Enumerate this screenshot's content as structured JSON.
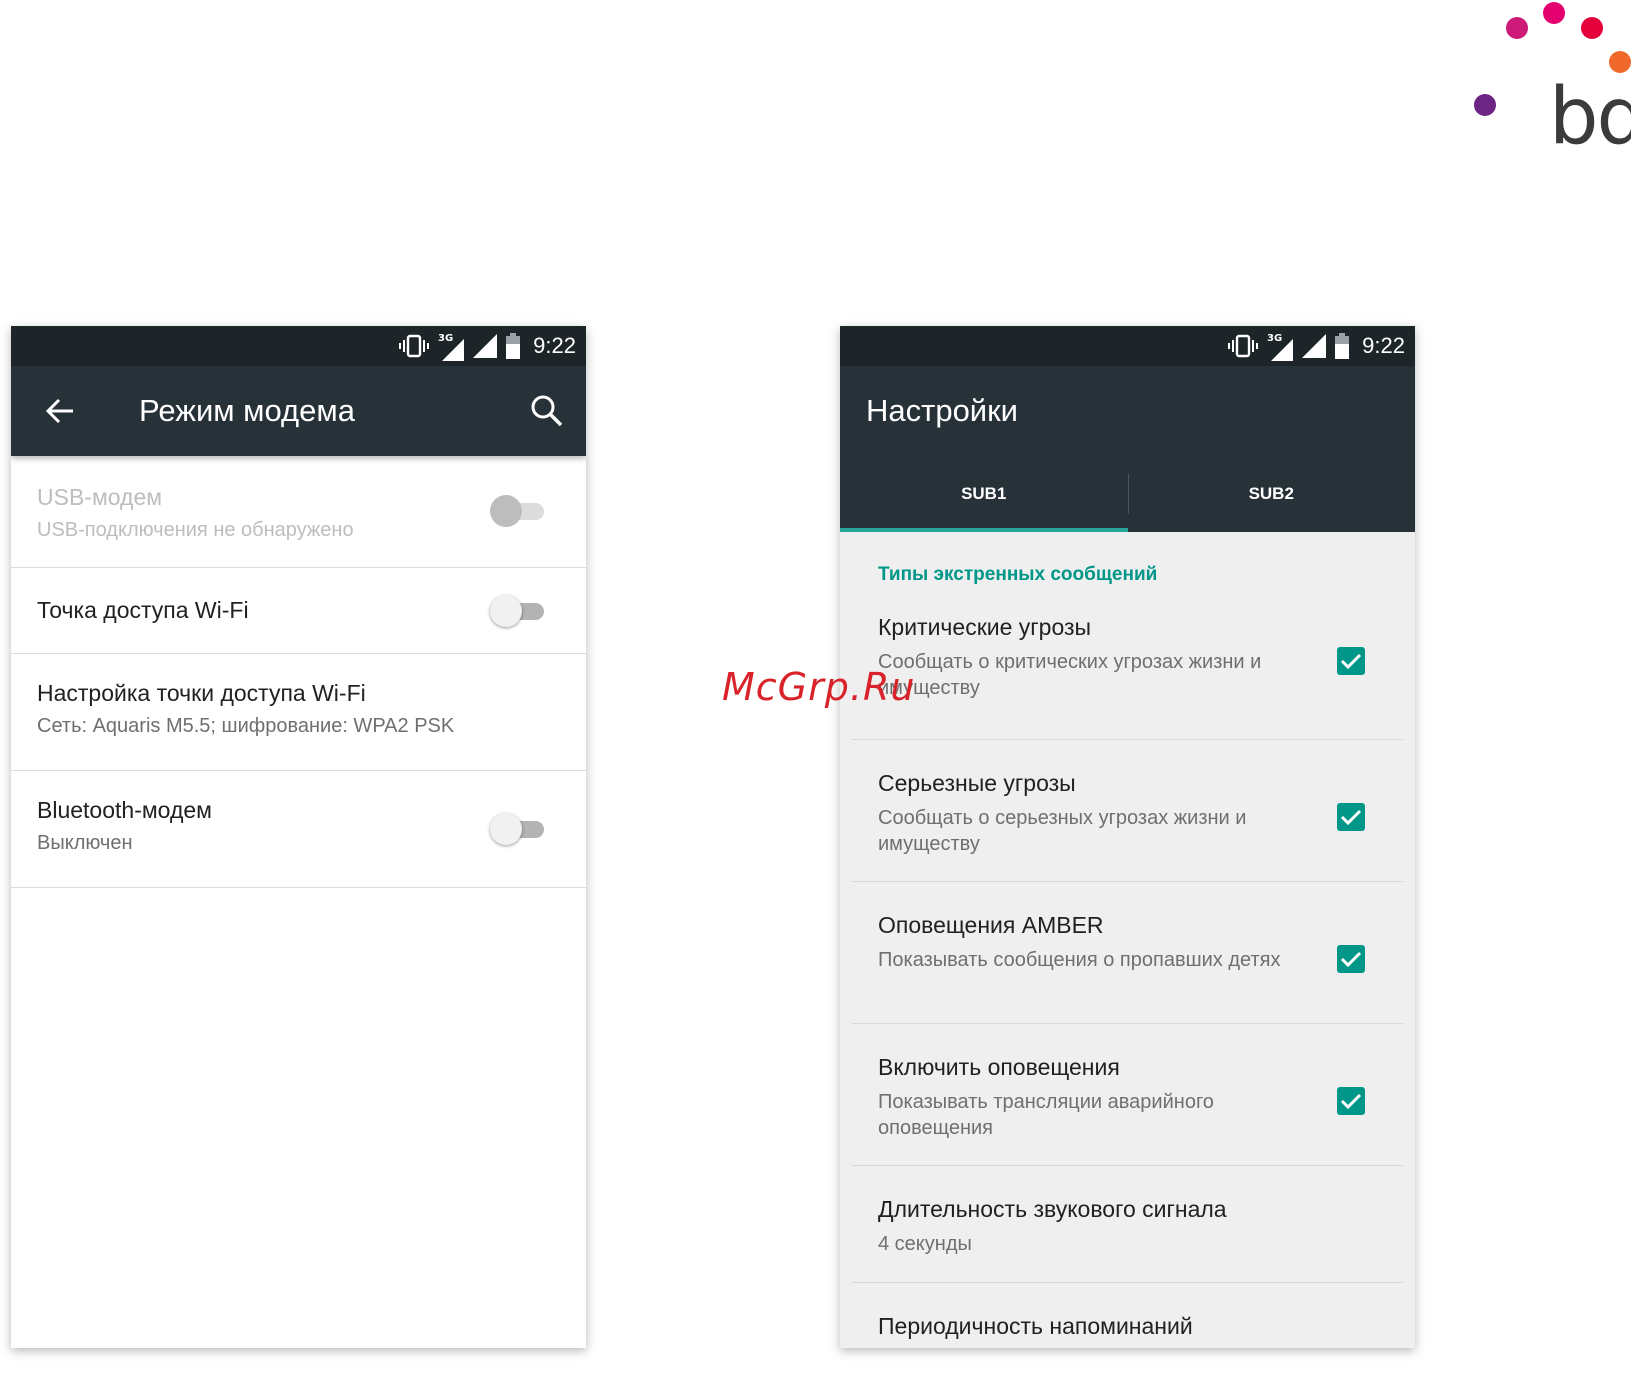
{
  "brand": {
    "logo_text": "bq",
    "dot_colors": [
      "#cc1a79",
      "#e4006e",
      "#e3003b",
      "#f0692b",
      "#6c2585"
    ]
  },
  "watermark": "McGrp.Ru",
  "colors": {
    "accent": "#009688",
    "statusbar": "#1d2528",
    "appbar": "#263238"
  },
  "left_screen": {
    "status": {
      "network": "3G",
      "time": "9:22",
      "icons": [
        "vibrate-icon",
        "signal-3g-icon",
        "signal-icon",
        "battery-icon"
      ]
    },
    "appbar": {
      "title": "Режим модема",
      "icons": [
        "back-arrow-icon",
        "search-icon"
      ]
    },
    "items": [
      {
        "title": "USB-модем",
        "subtitle": "USB-подключения не обнаружено",
        "toggle": "off",
        "enabled": false
      },
      {
        "title": "Точка доступа Wi-Fi",
        "subtitle": "",
        "toggle": "off",
        "enabled": true
      },
      {
        "title": "Настройка точки доступа Wi-Fi",
        "subtitle": "Сеть: Aquaris M5.5; шифрование: WPA2 PSK",
        "enabled": true
      },
      {
        "title": "Bluetooth-модем",
        "subtitle": "Выключен",
        "toggle": "off",
        "enabled": true
      }
    ]
  },
  "right_screen": {
    "status": {
      "network": "3G",
      "time": "9:22",
      "icons": [
        "vibrate-icon",
        "signal-3g-icon",
        "signal-icon",
        "battery-icon"
      ]
    },
    "appbar": {
      "title": "Настройки"
    },
    "tabs": [
      {
        "label": "SUB1",
        "active": true
      },
      {
        "label": "SUB2",
        "active": false
      }
    ],
    "section_header": "Типы экстренных сообщений",
    "items": [
      {
        "title": "Критические угрозы",
        "subtitle": "Сообщать о критических угрозах жизни и имуществу",
        "checked": true
      },
      {
        "title": "Серьезные угрозы",
        "subtitle": "Сообщать о серьезных угрозах жизни и имуществу",
        "checked": true
      },
      {
        "title": "Оповещения AMBER",
        "subtitle": "Показывать сообщения о пропавших детях",
        "checked": true
      },
      {
        "title": "Включить оповещения",
        "subtitle": "Показывать трансляции аварийного оповещения",
        "checked": true
      },
      {
        "title": "Длительность звукового сигнала",
        "subtitle": "4 секунды"
      },
      {
        "title": "Периодичность напоминаний",
        "subtitle": ""
      }
    ]
  }
}
